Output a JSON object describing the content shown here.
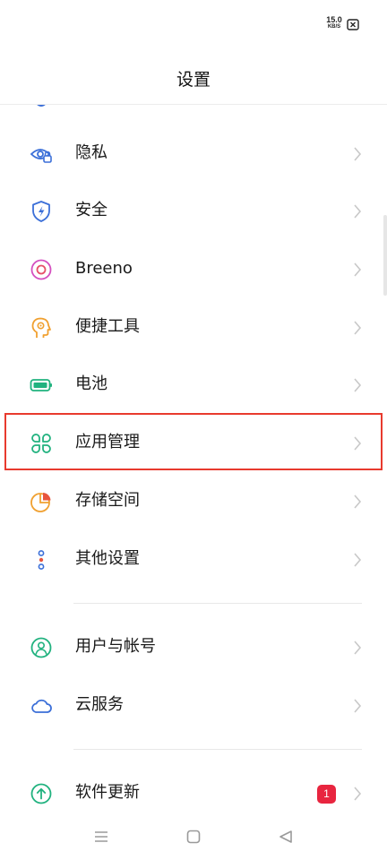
{
  "status_bar": {
    "net_speed": "15.0",
    "net_speed_unit": "KB/S",
    "sim_icon": "no-sim-icon"
  },
  "header": {
    "title": "设置"
  },
  "settings": {
    "items": [
      {
        "label": "隐私",
        "icon": "privacy-eye-icon",
        "icon_color": "#3b6fd8"
      },
      {
        "label": "安全",
        "icon": "security-shield-icon",
        "icon_color": "#3b6fd8"
      },
      {
        "label": "Breeno",
        "icon": "breeno-icon",
        "icon_color": "#d44fbf"
      },
      {
        "label": "便捷工具",
        "icon": "convenience-tools-icon",
        "icon_color": "#f0a030"
      },
      {
        "label": "电池",
        "icon": "battery-icon",
        "icon_color": "#21b27f"
      },
      {
        "label": "应用管理",
        "icon": "app-management-icon",
        "icon_color": "#21b27f"
      },
      {
        "label": "存储空间",
        "icon": "storage-pie-icon",
        "icon_color": "#f0a030"
      },
      {
        "label": "其他设置",
        "icon": "other-settings-icon",
        "icon_color": "#3b6fd8"
      },
      {
        "label": "用户与帐号",
        "icon": "user-account-icon",
        "icon_color": "#21b27f"
      },
      {
        "label": "云服务",
        "icon": "cloud-icon",
        "icon_color": "#3b6fd8"
      },
      {
        "label": "软件更新",
        "icon": "update-arrow-icon",
        "icon_color": "#21b27f",
        "badge": "1"
      }
    ]
  },
  "highlighted_item": "应用管理",
  "colors": {
    "highlight_border": "#e83a2e",
    "badge": "#e8253f",
    "chevron": "#c8c8c8"
  },
  "nav_bar": {
    "icons": [
      "menu-icon",
      "home-icon",
      "back-icon"
    ]
  }
}
